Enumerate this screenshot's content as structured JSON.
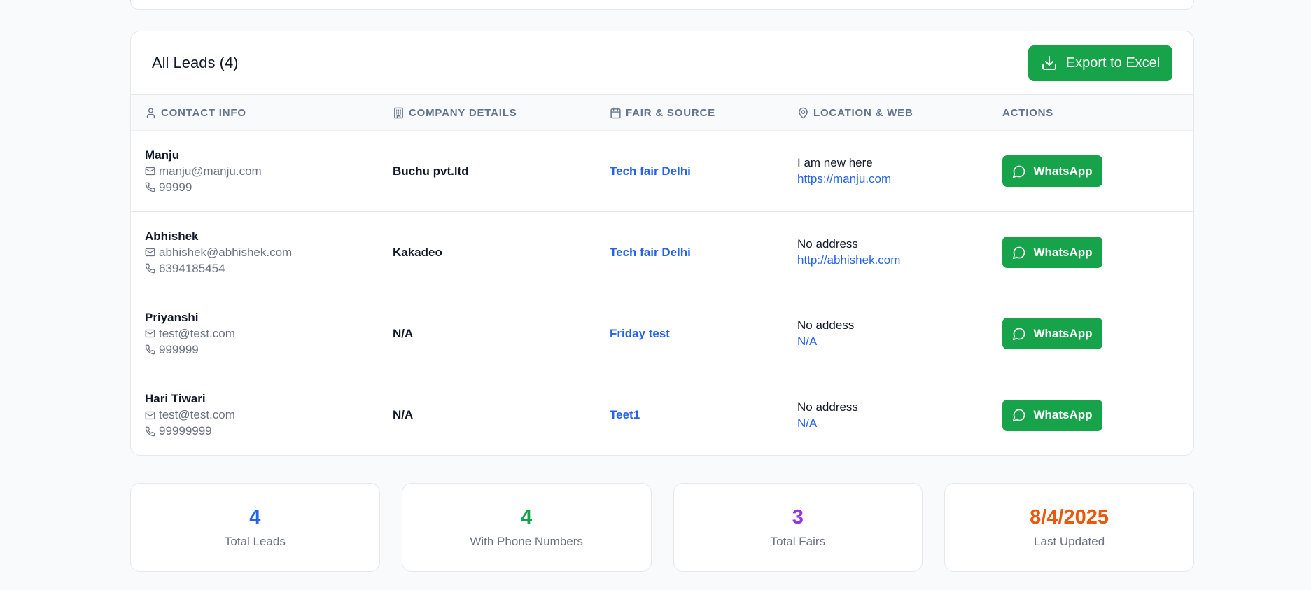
{
  "header": {
    "title": "All Leads (4)",
    "export_label": "Export to Excel"
  },
  "columns": {
    "contact": "Contact Info",
    "company": "Company Details",
    "fair": "Fair & Source",
    "location": "Location & Web",
    "actions": "Actions"
  },
  "leads": [
    {
      "name": "Manju",
      "email": "manju@manju.com",
      "phone": "99999",
      "company": "Buchu pvt.ltd",
      "fair": "Tech fair Delhi",
      "address": "I am new here",
      "website": "https://manju.com",
      "action": "WhatsApp"
    },
    {
      "name": "Abhishek",
      "email": "abhishek@abhishek.com",
      "phone": "6394185454",
      "company": "Kakadeo",
      "fair": "Tech fair Delhi",
      "address": "No address",
      "website": "http://abhishek.com",
      "action": "WhatsApp"
    },
    {
      "name": "Priyanshi",
      "email": "test@test.com",
      "phone": "999999",
      "company": "N/A",
      "fair": "Friday test",
      "address": "No addess",
      "website": "N/A",
      "action": "WhatsApp"
    },
    {
      "name": "Hari Tiwari",
      "email": "test@test.com",
      "phone": "99999999",
      "company": "N/A",
      "fair": "Teet1",
      "address": "No address",
      "website": "N/A",
      "action": "WhatsApp"
    }
  ],
  "stats": [
    {
      "value": "4",
      "label": "Total Leads",
      "color": "#2563eb"
    },
    {
      "value": "4",
      "label": "With Phone Numbers",
      "color": "#16a34a"
    },
    {
      "value": "3",
      "label": "Total Fairs",
      "color": "#9333ea"
    },
    {
      "value": "8/4/2025",
      "label": "Last Updated",
      "color": "#ea580c"
    }
  ],
  "colors": {
    "accent_green": "#16a34a",
    "link_blue": "#2563eb"
  }
}
